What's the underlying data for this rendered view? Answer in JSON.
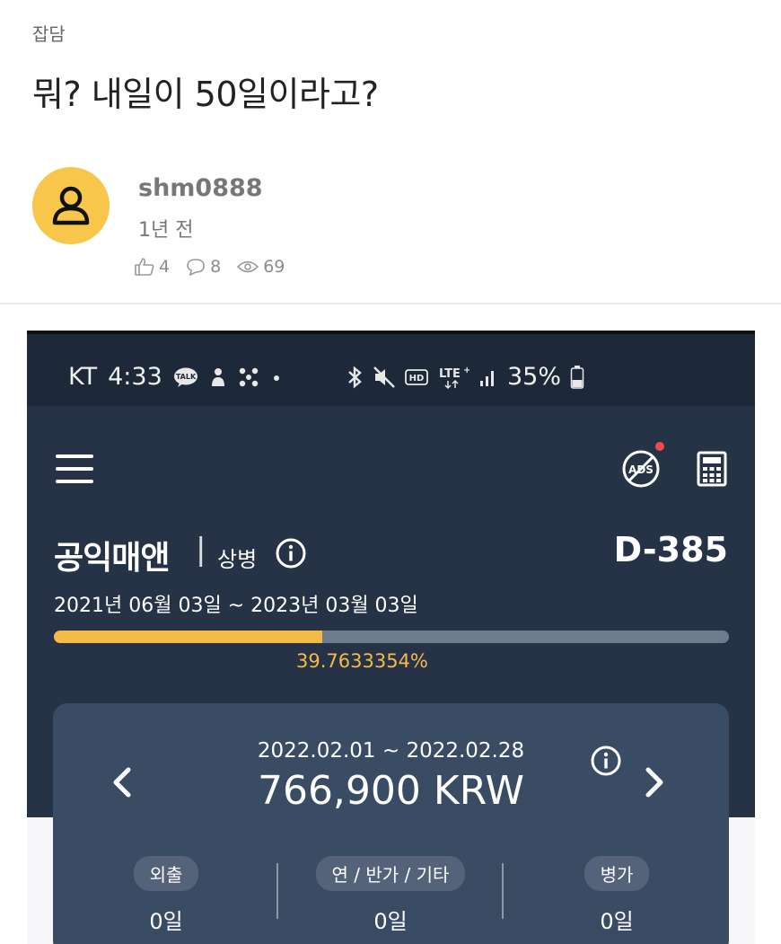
{
  "post": {
    "category": "잡담",
    "title": "뭐? 내일이 50일이라고?",
    "author": "shm0888",
    "time": "1년 전",
    "likes": "4",
    "comments": "8",
    "views": "69"
  },
  "phone": {
    "status_left": [
      "KT",
      "4:33"
    ],
    "status_right": "35%",
    "app_name": "공익매앤",
    "separator": "|",
    "rank": "상병",
    "dday": "D-385",
    "service_period": "2021년 06월 03일  ~  2023년 03월 03일",
    "progress_value": 0.397633354,
    "progress_label": "39.7633354%",
    "card": {
      "period": "2022.02.01 ~ 2022.02.28",
      "amount": "766,900 KRW",
      "columns": [
        {
          "label": "외출",
          "value": "0일"
        },
        {
          "label": "연 / 반가 / 기타",
          "value": "0일"
        },
        {
          "label": "병가",
          "value": "0일"
        }
      ]
    }
  },
  "colors": {
    "avatar": "#f7c64b",
    "app_bg": "#263246",
    "statusbar_bg": "#1d2838",
    "card_bg": "#3a4c64",
    "progress_fill": "#f4bb47",
    "progress_track": "#6e7d8e"
  },
  "icons": [
    "user-icon",
    "thumbs-up-icon",
    "comment-icon",
    "eye-icon",
    "menu-icon",
    "no-ads-icon",
    "calculator-icon",
    "info-icon",
    "chevron-left-icon",
    "chevron-right-icon"
  ]
}
